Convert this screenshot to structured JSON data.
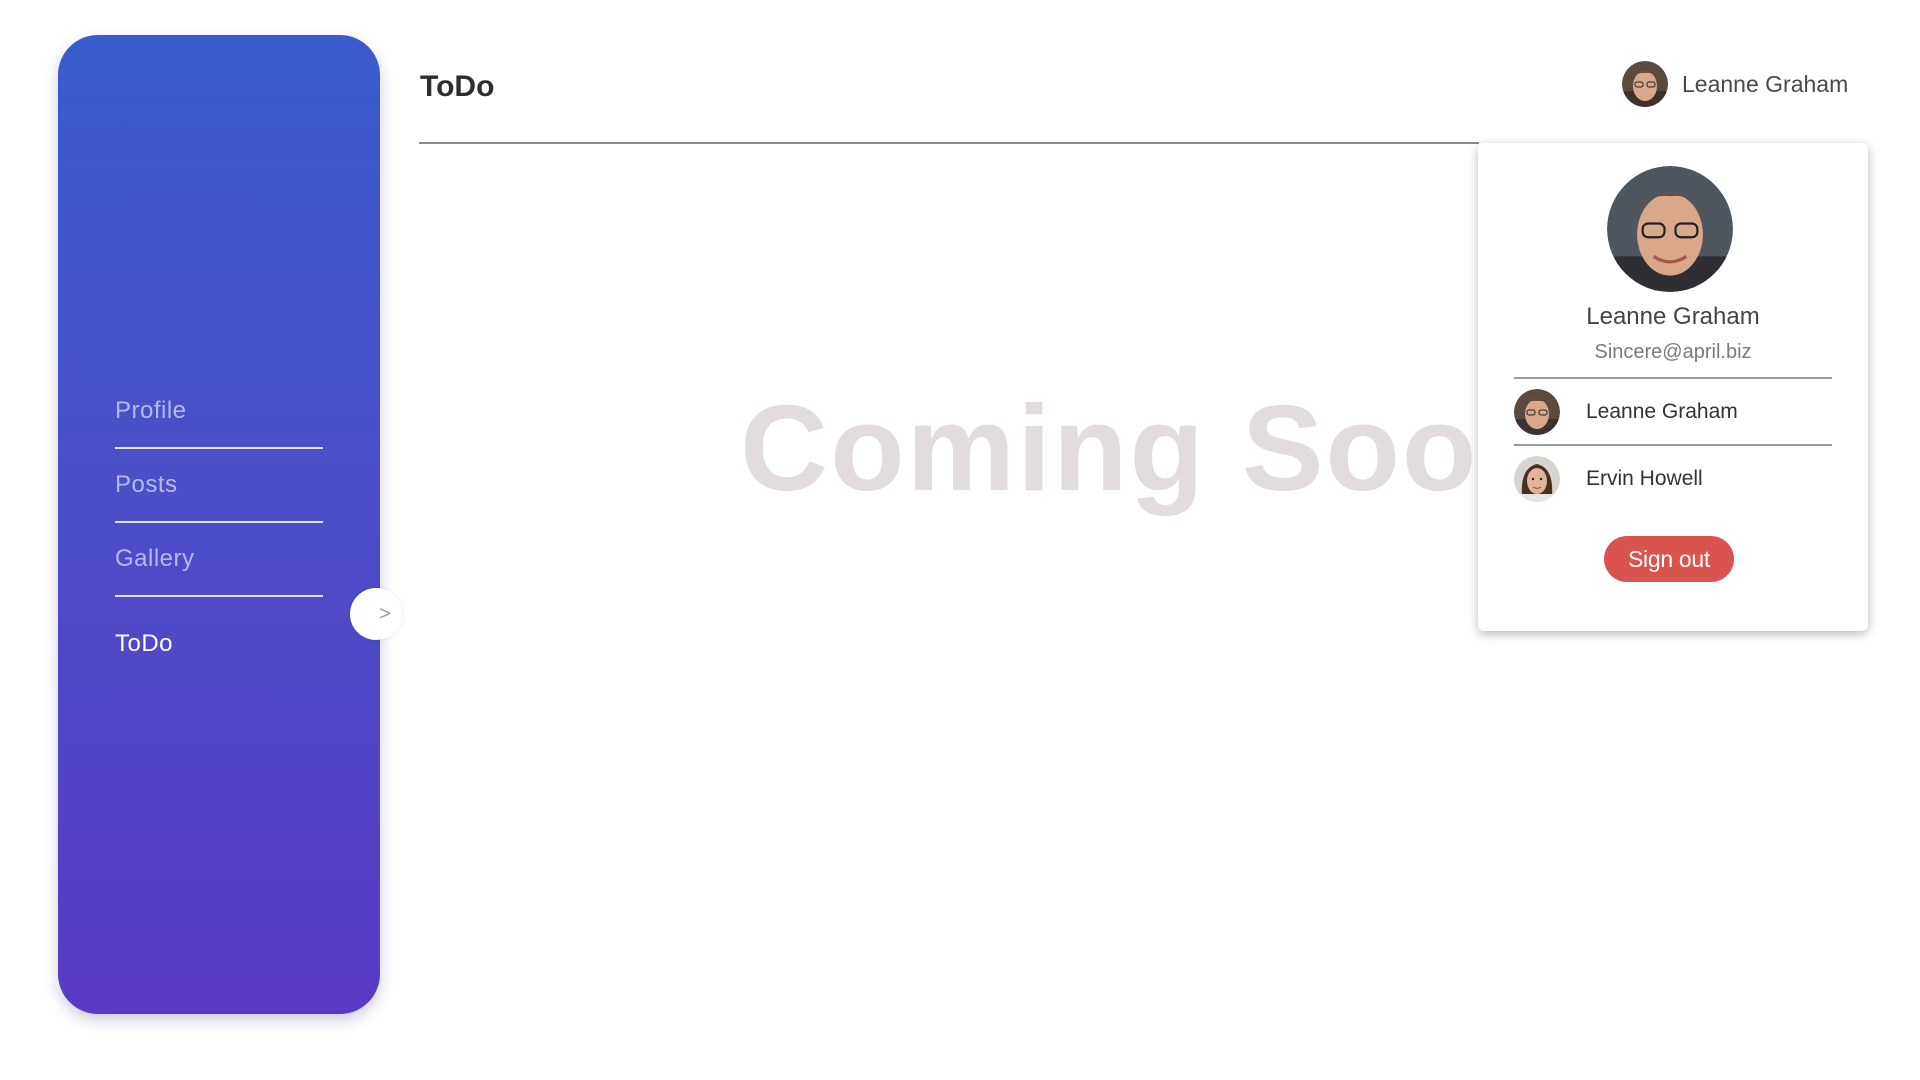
{
  "sidebar": {
    "items": [
      {
        "label": "Profile"
      },
      {
        "label": "Posts"
      },
      {
        "label": "Gallery"
      },
      {
        "label": "ToDo"
      }
    ],
    "toggle_label": ">"
  },
  "header": {
    "title": "ToDo",
    "user_name": "Leanne Graham"
  },
  "main": {
    "coming_soon": "Coming Soon"
  },
  "dropdown": {
    "name": "Leanne Graham",
    "email": "Sincere@april.biz",
    "accounts": [
      {
        "name": "Leanne Graham"
      },
      {
        "name": "Ervin Howell"
      }
    ],
    "signout_label": "Sign out"
  },
  "colors": {
    "sidebar_gradient_top": "#3a5bcc",
    "sidebar_gradient_bottom": "#5a3ac6",
    "signout": "#d9534f",
    "coming_soon": "#e2dcdc"
  }
}
